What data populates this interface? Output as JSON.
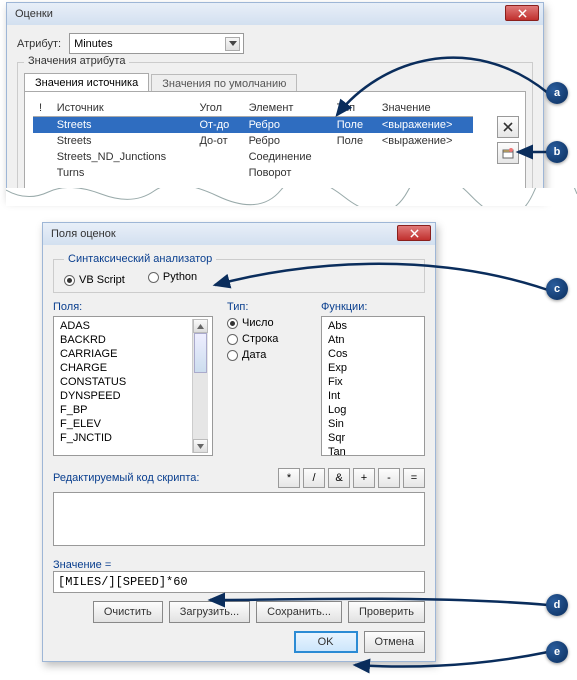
{
  "top_window": {
    "title": "Оценки",
    "attribute_label": "Атрибут:",
    "attribute_value": "Minutes",
    "group_label": "Значения атрибута",
    "tab_active": "Значения источника",
    "tab_inactive": "Значения по умолчанию",
    "columns": {
      "bang": "!",
      "source": "Источник",
      "angle": "Угол",
      "element": "Элемент",
      "type": "Тип",
      "value": "Значение"
    },
    "rows": [
      {
        "source": "Streets",
        "angle": "От-до",
        "element": "Ребро",
        "type": "Поле",
        "value": "<выражение>",
        "selected": true
      },
      {
        "source": "Streets",
        "angle": "До-от",
        "element": "Ребро",
        "type": "Поле",
        "value": "<выражение>"
      },
      {
        "source": "Streets_ND_Junctions",
        "angle": "",
        "element": "Соединение",
        "type": "",
        "value": ""
      },
      {
        "source": "Turns",
        "angle": "",
        "element": "Поворот",
        "type": "",
        "value": ""
      }
    ]
  },
  "dialog": {
    "title": "Поля оценок",
    "parser_label": "Синтаксический анализатор",
    "vbscript_label": "VB Script",
    "python_label": "Python",
    "fields_label": "Поля:",
    "type_label": "Тип:",
    "funcs_label": "Функции:",
    "fields": [
      "ADAS",
      "BACKRD",
      "CARRIAGE",
      "CHARGE",
      "CONSTATUS",
      "DYNSPEED",
      "F_BP",
      "F_ELEV",
      "F_JNCTID"
    ],
    "type_num": "Число",
    "type_str": "Строка",
    "type_date": "Дата",
    "functions": [
      "Abs",
      "Atn",
      "Cos",
      "Exp",
      "Fix",
      "Int",
      "Log",
      "Sin",
      "Sqr",
      "Tan"
    ],
    "code_label": "Редактируемый код скрипта:",
    "ops": {
      "mul": "*",
      "div": "/",
      "amp": "&",
      "plus": "+",
      "minus": "-",
      "eq": "="
    },
    "value_label": "Значение =",
    "expression": "[MILES/][SPEED]*60",
    "buttons": {
      "clear": "Очистить",
      "load": "Загрузить...",
      "save": "Сохранить...",
      "check": "Проверить",
      "ok": "OK",
      "cancel": "Отмена"
    }
  },
  "callouts": {
    "a": "a",
    "b": "b",
    "c": "c",
    "d": "d",
    "e": "e"
  }
}
